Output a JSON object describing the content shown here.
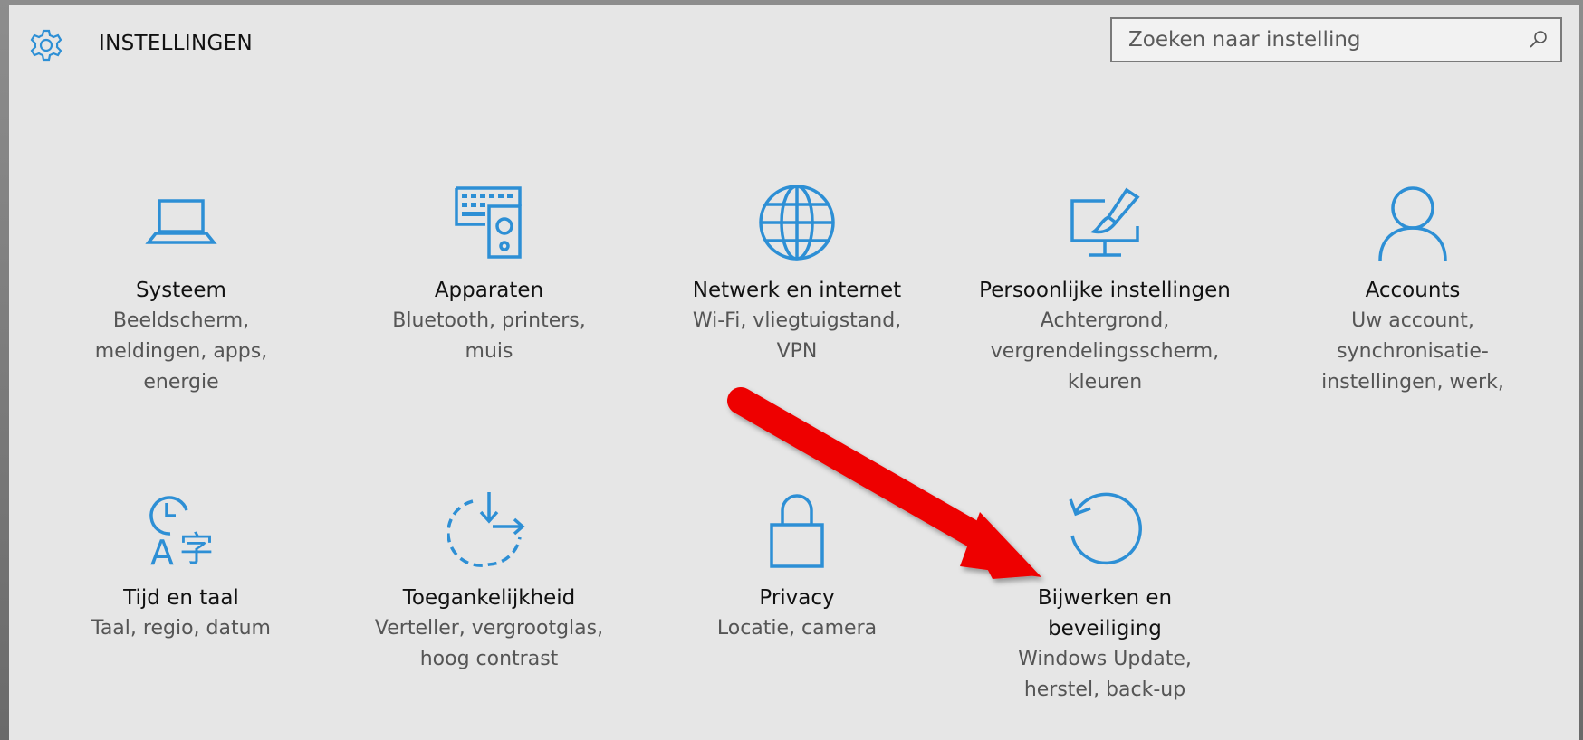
{
  "header": {
    "title": "INSTELLINGEN",
    "icon": "gear-icon"
  },
  "search": {
    "placeholder": "Zoeken naar instelling",
    "value": "",
    "icon": "search-icon"
  },
  "colors": {
    "accent": "#2d8fd5",
    "annotation_arrow": "#ee0000"
  },
  "tiles": [
    {
      "icon": "laptop-icon",
      "title": "Systeem",
      "description": [
        "Beeldscherm,",
        "meldingen, apps,",
        "energie"
      ]
    },
    {
      "icon": "keyboard-speaker-icon",
      "title": "Apparaten",
      "description": [
        "Bluetooth, printers,",
        "muis"
      ]
    },
    {
      "icon": "globe-icon",
      "title": "Netwerk en internet",
      "description": [
        "Wi-Fi, vliegtuigstand,",
        "VPN"
      ]
    },
    {
      "icon": "monitor-brush-icon",
      "title": "Persoonlijke instellingen",
      "description": [
        "Achtergrond,",
        "vergrendelingsscherm,",
        "kleuren"
      ]
    },
    {
      "icon": "person-icon",
      "title": "Accounts",
      "description": [
        "Uw account,",
        "synchronisatie-",
        "instellingen, werk,"
      ]
    },
    {
      "icon": "clock-language-icon",
      "title": "Tijd en taal",
      "description": [
        "Taal, regio, datum"
      ]
    },
    {
      "icon": "accessibility-icon",
      "title": "Toegankelijkheid",
      "description": [
        "Verteller, vergrootglas,",
        "hoog contrast"
      ]
    },
    {
      "icon": "padlock-icon",
      "title": "Privacy",
      "description": [
        "Locatie, camera"
      ]
    },
    {
      "icon": "refresh-icon",
      "title": [
        "Bijwerken en",
        "beveiliging"
      ],
      "description": [
        "Windows Update,",
        "herstel, back-up"
      ]
    }
  ]
}
